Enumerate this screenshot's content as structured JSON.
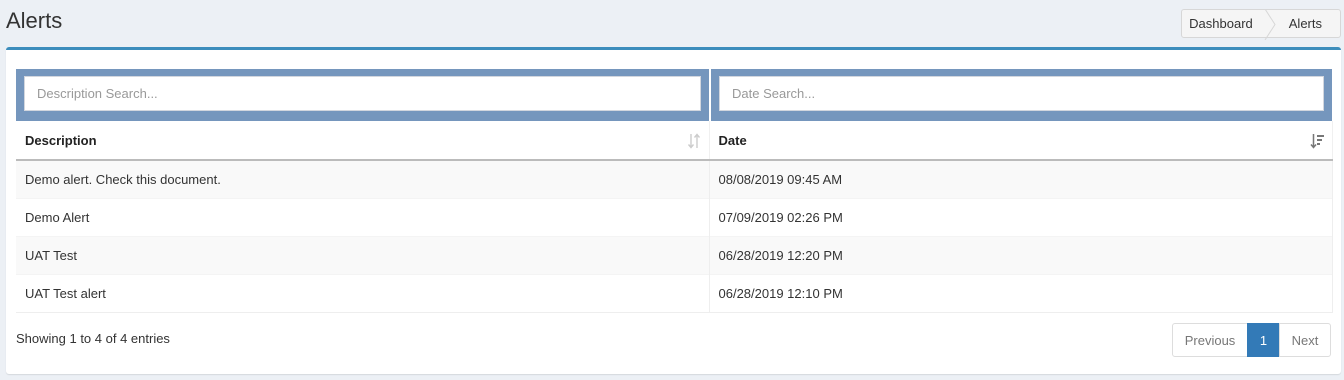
{
  "header": {
    "title": "Alerts",
    "breadcrumb": [
      "Dashboard",
      "Alerts"
    ]
  },
  "search": {
    "description_placeholder": "Description Search...",
    "date_placeholder": "Date Search..."
  },
  "table": {
    "columns": [
      "Description",
      "Date"
    ],
    "rows": [
      {
        "description": "Demo alert. Check this document.",
        "date": "08/08/2019 09:45 AM"
      },
      {
        "description": "Demo Alert",
        "date": "07/09/2019 02:26 PM"
      },
      {
        "description": "UAT Test",
        "date": "06/28/2019 12:20 PM"
      },
      {
        "description": "UAT Test alert",
        "date": "06/28/2019 12:10 PM"
      }
    ]
  },
  "footer": {
    "info": "Showing 1 to 4 of 4 entries",
    "pagination": {
      "previous": "Previous",
      "current": "1",
      "next": "Next"
    }
  },
  "colors": {
    "accent": "#3c8dbc",
    "search_bar": "#7596bd",
    "active_page": "#337ab7"
  },
  "icons": {
    "description_sort": "sort-both-icon",
    "date_sort": "sort-desc-icon"
  }
}
